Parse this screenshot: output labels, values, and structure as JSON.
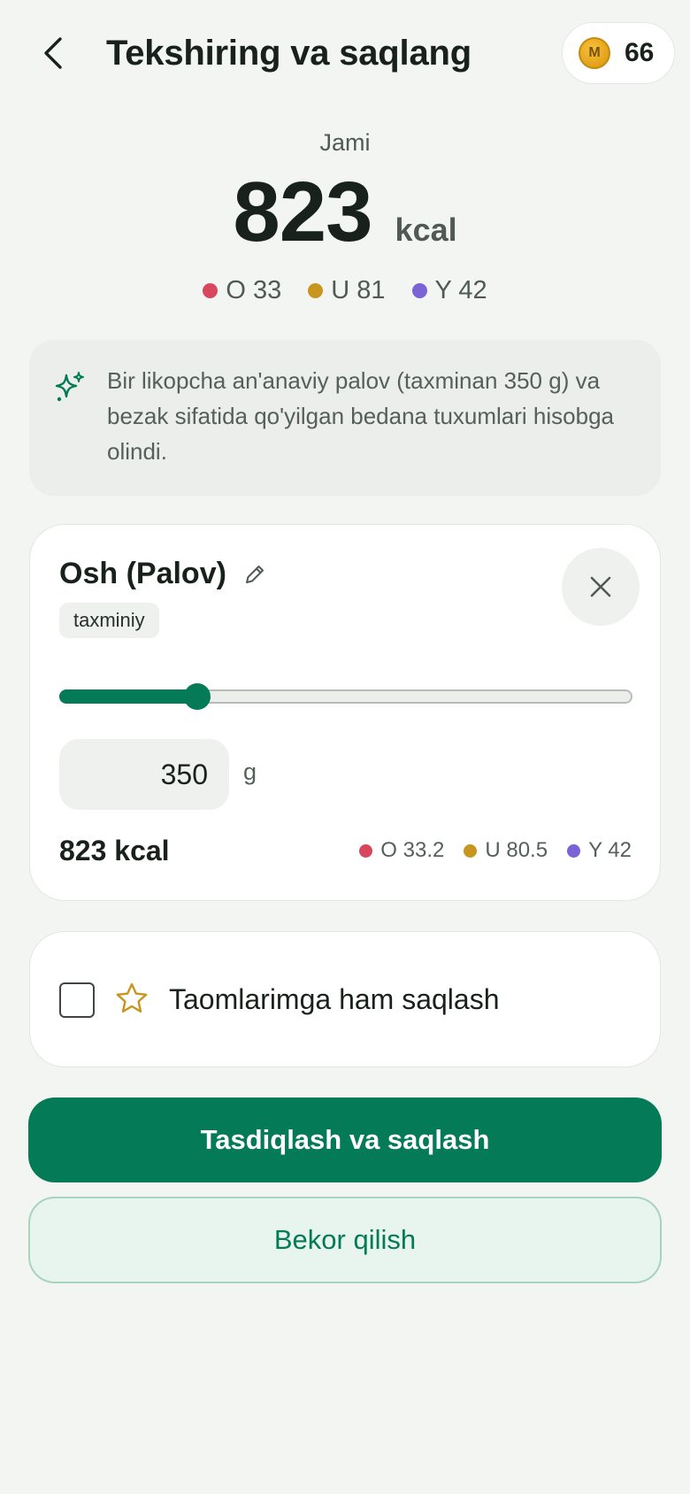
{
  "header": {
    "title": "Tekshiring va saqlang",
    "back_icon": "chevron-left-icon",
    "coins": {
      "icon_letter": "M",
      "count": "66"
    }
  },
  "totals": {
    "label": "Jami",
    "value": "823",
    "unit": "kcal",
    "macros": [
      {
        "label": "O 33",
        "color": "#d9475e"
      },
      {
        "label": "U 81",
        "color": "#c8951f"
      },
      {
        "label": "Y 42",
        "color": "#7b62d6"
      }
    ]
  },
  "note": {
    "icon": "sparkle-icon",
    "text": "Bir likopcha an'anaviy palov (taxminan 350 g) va bezak sifatida qo'yilgan bedana tuxumlari hisobga olindi."
  },
  "food": {
    "name": "Osh (Palov)",
    "badge": "taxminiy",
    "slider_fraction": 0.24,
    "grams": "350",
    "grams_unit": "g",
    "kcal": "823 kcal",
    "macros": [
      {
        "label": "O 33.2",
        "color": "#d9475e"
      },
      {
        "label": "U 80.5",
        "color": "#c8951f"
      },
      {
        "label": "Y 42",
        "color": "#7b62d6"
      }
    ]
  },
  "favorite": {
    "label": "Taomlarimga ham saqlash",
    "checked": false,
    "icon": "star-icon"
  },
  "actions": {
    "confirm_label": "Tasdiqlash va saqlash",
    "cancel_label": "Bekor qilish"
  },
  "colors": {
    "accent": "#047a56",
    "background": "#f2f5f2"
  }
}
